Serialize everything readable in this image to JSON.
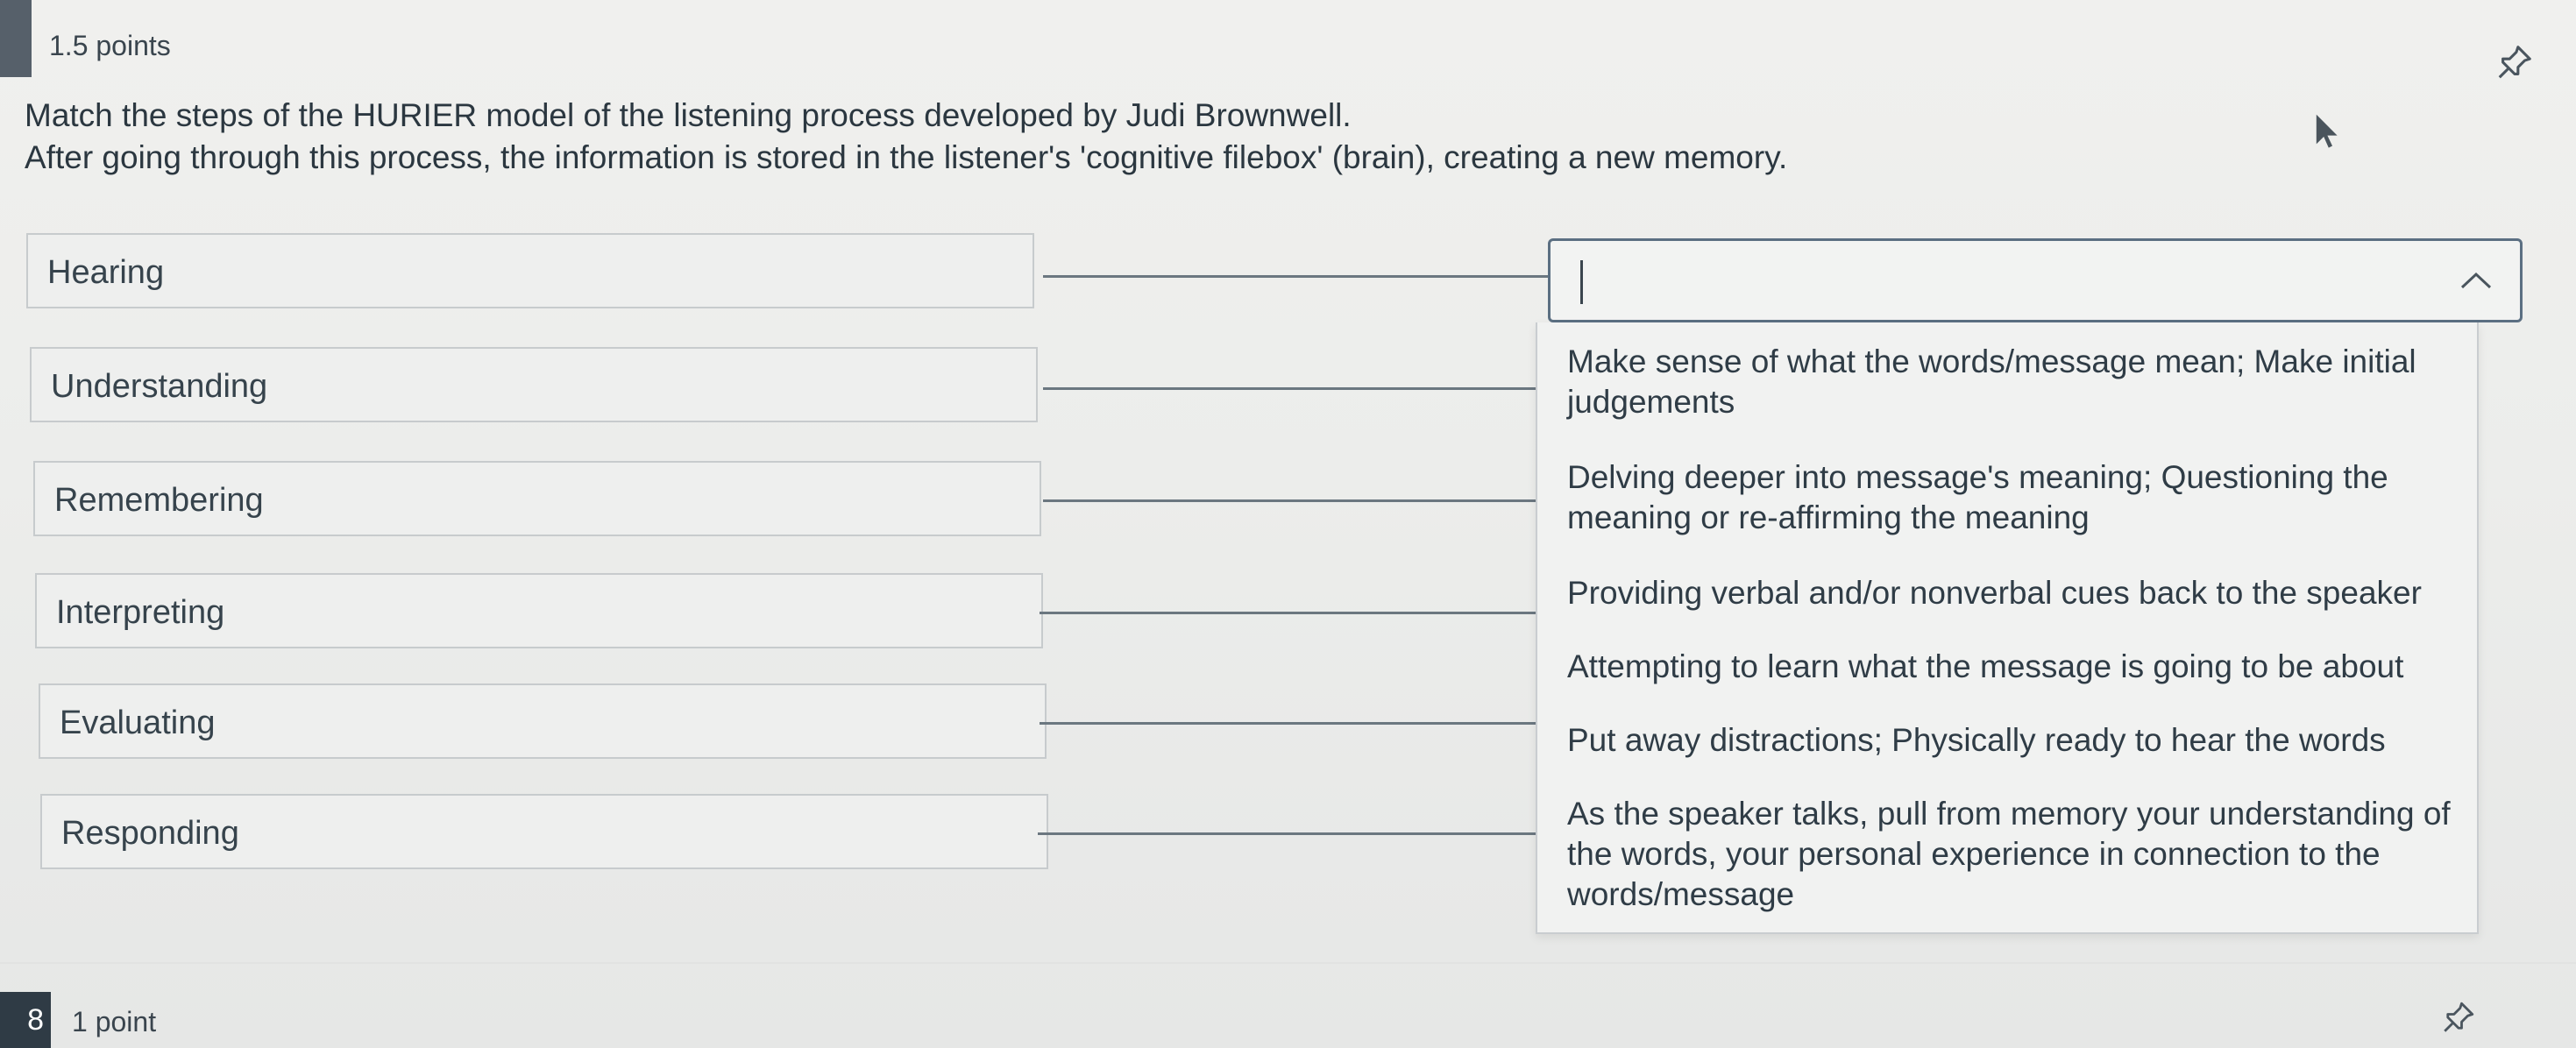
{
  "question": {
    "points": "1.5 points",
    "prompt_line1": "Match the steps of the HURIER model of the listening process developed by Judi Brownwell.",
    "prompt_line2": "After going through this process, the information is stored in the listener's 'cognitive filebox' (brain), creating a new memory."
  },
  "terms": [
    "Hearing",
    "Understanding",
    "Remembering",
    "Interpreting",
    "Evaluating",
    "Responding"
  ],
  "select": {
    "current_value": "",
    "options": [
      "Make sense of what the words/message mean; Make initial judgements",
      "Delving deeper into message's meaning; Questioning the meaning or re-affirming the meaning",
      "Providing verbal and/or nonverbal cues back to the speaker",
      "Attempting to learn what the message is going to be about",
      "Put away distractions; Physically ready to hear the words",
      "As the speaker talks, pull from memory your understanding of the words, your personal experience in connection to the words/message"
    ]
  },
  "next_question": {
    "number": "8",
    "points": "1 point"
  },
  "icons": {
    "pin": "pin-icon",
    "chevron": "chevron-up-icon",
    "pointer": "mouse-pointer-icon"
  }
}
